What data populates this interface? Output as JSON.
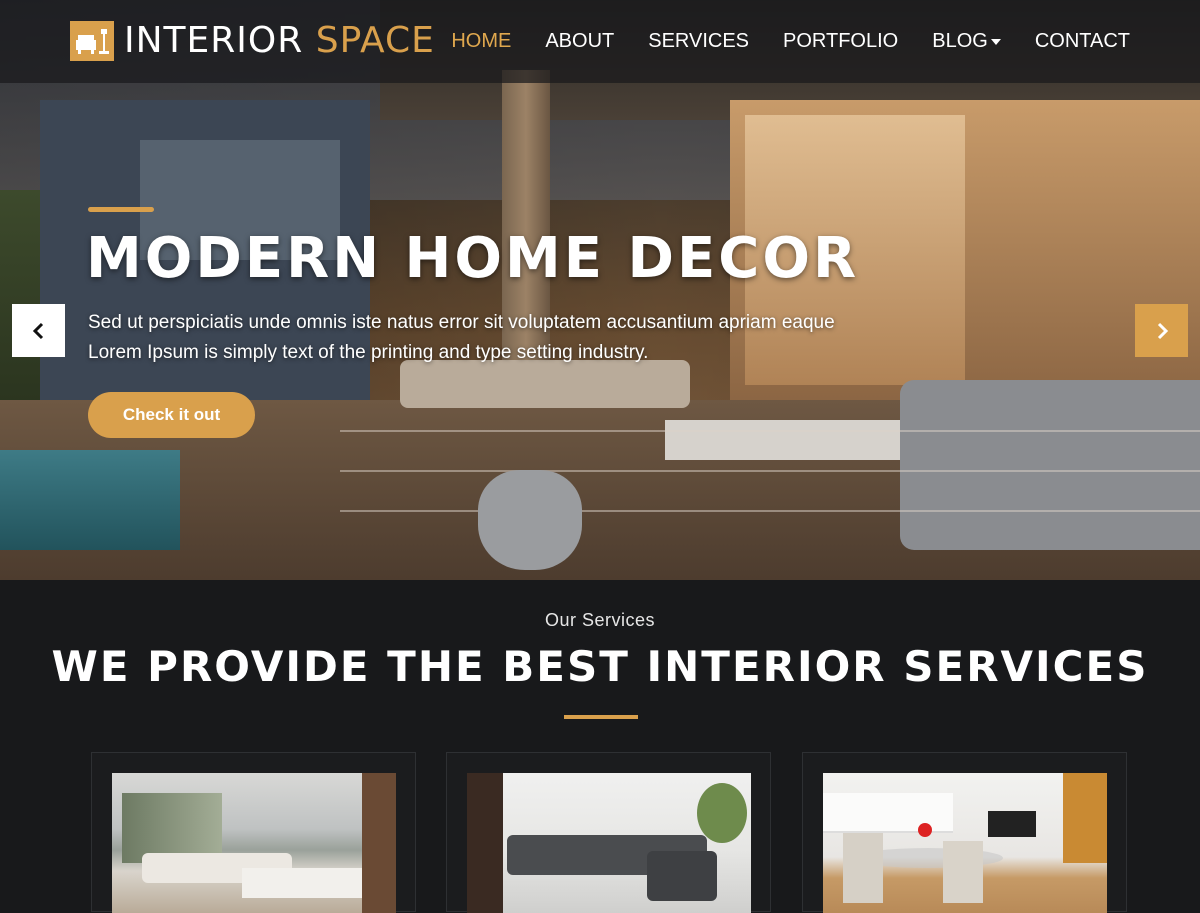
{
  "header": {
    "logo_main": "INTERIOR",
    "logo_accent": "SPACE",
    "logo_icon": "armchair-lamp-icon",
    "nav": [
      {
        "label": "HOME",
        "active": true
      },
      {
        "label": "ABOUT",
        "active": false
      },
      {
        "label": "SERVICES",
        "active": false
      },
      {
        "label": "PORTFOLIO",
        "active": false
      },
      {
        "label": "BLOG",
        "active": false,
        "dropdown": true
      },
      {
        "label": "CONTACT",
        "active": false
      }
    ]
  },
  "hero": {
    "title": "MODERN HOME DECOR",
    "line1": "Sed ut perspiciatis unde omnis iste natus error sit voluptatem accusantium apriam eaque",
    "line2": "Lorem Ipsum is simply text of the printing and type setting industry.",
    "button": "Check it out",
    "prev_icon": "chevron-left-icon",
    "next_icon": "chevron-right-icon"
  },
  "services": {
    "subtitle": "Our Services",
    "title": "WE PROVIDE THE BEST INTERIOR SERVICES",
    "cards": [
      {
        "image": "living-room-photo"
      },
      {
        "image": "sectional-sofa-photo"
      },
      {
        "image": "dining-kitchen-photo"
      }
    ]
  },
  "colors": {
    "accent": "#d9a04c",
    "background": "#18191b"
  }
}
